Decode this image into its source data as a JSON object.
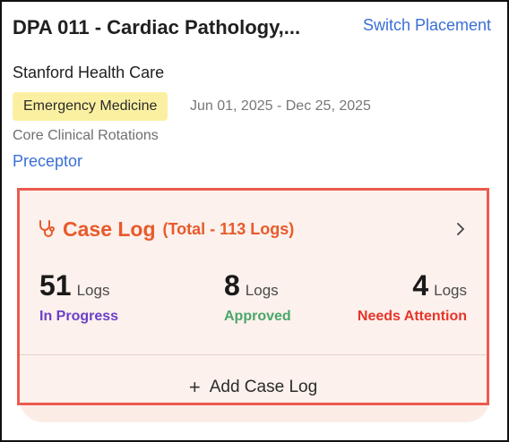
{
  "placement": {
    "title": "DPA 011 - Cardiac Pathology,...",
    "switch_label": "Switch Placement",
    "organization": "Stanford Health Care",
    "specialty": "Emergency Medicine",
    "date_range": "Jun 01, 2025 - Dec 25, 2025",
    "rotation": "Core Clinical Rotations",
    "preceptor_label": "Preceptor"
  },
  "case_log": {
    "title": "Case Log",
    "total": "(Total - 113 Logs)",
    "icon": "stethoscope-icon",
    "stats": [
      {
        "count": "51",
        "unit": "Logs",
        "label": "In Progress",
        "color": "#6b3fc9"
      },
      {
        "count": "8",
        "unit": "Logs",
        "label": "Approved",
        "color": "#4aa66a"
      },
      {
        "count": "4",
        "unit": "Logs",
        "label": "Needs Attention",
        "color": "#e8342a"
      }
    ],
    "add_label": "Add Case Log"
  },
  "colors": {
    "link": "#3b6fd8",
    "accent": "#e85a2b",
    "highlight_border": "#ec5a4d",
    "badge_bg": "#fbf0a1",
    "card_bg": "#fcf1ec"
  }
}
